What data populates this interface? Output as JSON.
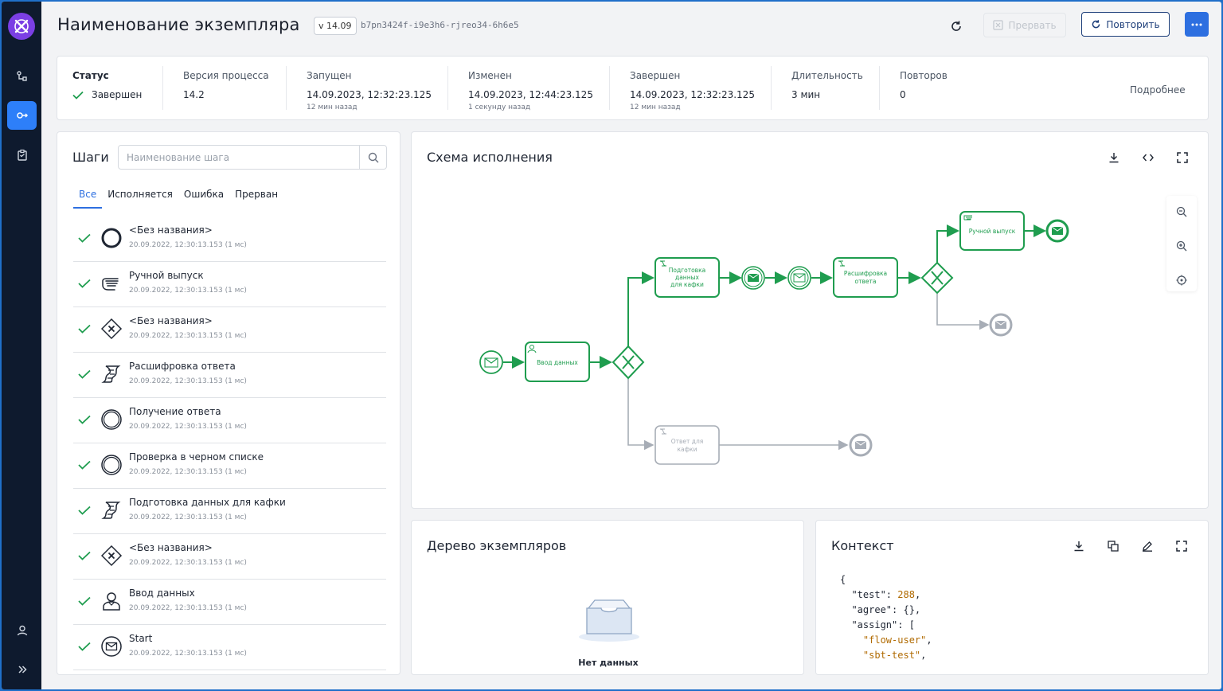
{
  "header": {
    "title": "Наименование экземпляра",
    "version": "v 14.09",
    "hash": "b7pn3424f-i9e3h6-rjreo34-6h6e5",
    "abort_label": "Прервать",
    "repeat_label": "Повторить"
  },
  "status": {
    "status_label": "Статус",
    "status_value": "Завершен",
    "version_label": "Версия процесса",
    "version_value": "14.2",
    "started_label": "Запущен",
    "started_value": "14.09.2023, 12:32:23.125",
    "started_sub": "12 мин назад",
    "changed_label": "Изменен",
    "changed_value": "14.09.2023, 12:44:23.125",
    "changed_sub": "1 секунду назад",
    "finished_label": "Завершен",
    "finished_value": "14.09.2023, 12:32:23.125",
    "finished_sub": "12 мин назад",
    "duration_label": "Длительность",
    "duration_value": "3 мин",
    "retries_label": "Повторов",
    "retries_value": "0",
    "details_link": "Подробнее"
  },
  "steps": {
    "title": "Шаги",
    "search_placeholder": "Наименование шага",
    "tabs": [
      "Все",
      "Исполняется",
      "Ошибка",
      "Прерван"
    ],
    "items": [
      {
        "name": "<Без названия>",
        "time": "20.09.2022, 12:30:13.153 (1 мс)",
        "icon": "end-event-icon"
      },
      {
        "name": "Ручной выпуск",
        "time": "20.09.2022, 12:30:13.153 (1 мс)",
        "icon": "manual-task-icon"
      },
      {
        "name": "<Без названия>",
        "time": "20.09.2022, 12:30:13.153 (1 мс)",
        "icon": "exclusive-gateway-icon"
      },
      {
        "name": "Расшифровка ответа",
        "time": "20.09.2022, 12:30:13.153 (1 мс)",
        "icon": "script-task-icon"
      },
      {
        "name": "Получение ответа",
        "time": "20.09.2022, 12:30:13.153 (1 мс)",
        "icon": "intermediate-event-icon"
      },
      {
        "name": "Проверка в черном списке",
        "time": "20.09.2022, 12:30:13.153 (1 мс)",
        "icon": "intermediate-event-icon"
      },
      {
        "name": "Подготовка данных для кафки",
        "time": "20.09.2022, 12:30:13.153 (1 мс)",
        "icon": "script-task-icon"
      },
      {
        "name": "<Без названия>",
        "time": "20.09.2022, 12:30:13.153 (1 мс)",
        "icon": "exclusive-gateway-icon"
      },
      {
        "name": "Ввод данных",
        "time": "20.09.2022, 12:30:13.153 (1 мс)",
        "icon": "user-task-icon"
      },
      {
        "name": "Start",
        "time": "20.09.2022, 12:30:13.153 (1 мс)",
        "icon": "message-start-icon"
      }
    ]
  },
  "schema": {
    "title": "Схема исполнения",
    "nodes": {
      "input": "Ввод данных",
      "prepare": [
        "Подготовка",
        "данных",
        "для кафки"
      ],
      "decode": [
        "Расшифровка",
        "ответа"
      ],
      "manual": "Ручной выпуск",
      "kafka_reply": [
        "Ответ для",
        "кафки"
      ]
    }
  },
  "tree": {
    "title": "Дерево экземпляров",
    "empty": "Нет данных"
  },
  "context": {
    "title": "Контекст",
    "lines": [
      {
        "k": "{",
        "v": ""
      },
      {
        "k": "  \"test\": ",
        "v": "288",
        "t": ","
      },
      {
        "k": "  \"agree\": {},",
        "v": ""
      },
      {
        "k": "  \"assign\": [",
        "v": ""
      },
      {
        "k": "    ",
        "v": "\"flow-user\"",
        "t": ","
      },
      {
        "k": "    ",
        "v": "\"sbt-test\"",
        "t": ","
      }
    ]
  },
  "colors": {
    "accent": "#2d6fe0",
    "success": "#1f9d4f",
    "sidebar": "#0e1a2e",
    "inactive": "#a7adb6"
  }
}
